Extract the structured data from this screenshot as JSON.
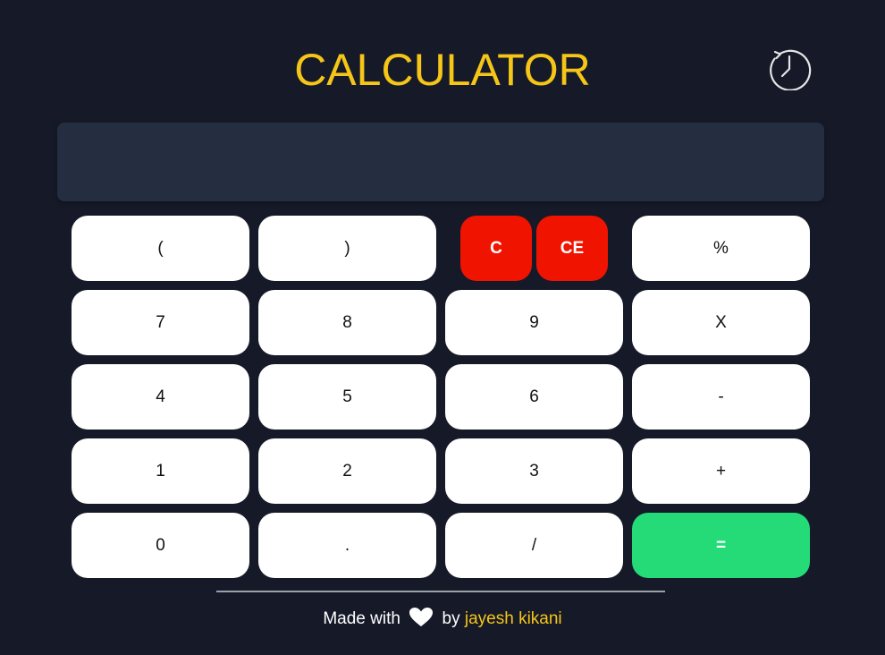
{
  "header": {
    "title": "CALCULATOR",
    "history_icon": "history-clock-icon"
  },
  "display": {
    "value": ""
  },
  "keys": {
    "open_paren": "(",
    "close_paren": ")",
    "clear": "C",
    "clear_entry": "CE",
    "percent": "%",
    "seven": "7",
    "eight": "8",
    "nine": "9",
    "multiply": "X",
    "four": "4",
    "five": "5",
    "six": "6",
    "minus": "-",
    "one": "1",
    "two": "2",
    "three": "3",
    "plus": "+",
    "zero": "0",
    "dot": ".",
    "divide": "/",
    "equals": "="
  },
  "footer": {
    "made_with": "Made with",
    "heart_icon": "heart-icon",
    "by": "by",
    "author": "jayesh kikani"
  },
  "colors": {
    "background": "#161a28",
    "display": "#242e40",
    "accent_yellow": "#f5c518",
    "clear_red": "#f01400",
    "equals_green": "#24db78",
    "key_white": "#ffffff"
  }
}
